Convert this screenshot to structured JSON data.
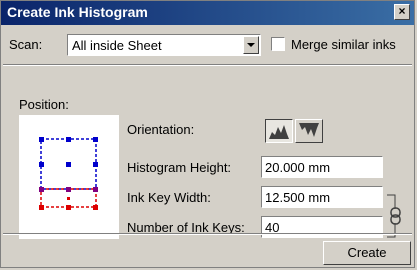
{
  "window": {
    "title": "Create Ink Histogram",
    "close_glyph": "×"
  },
  "scan": {
    "label": "Scan:",
    "selected": "All inside Sheet"
  },
  "merge": {
    "label": "Merge similar inks",
    "checked": false
  },
  "position": {
    "label": "Position:"
  },
  "orientation": {
    "label": "Orientation:",
    "icons": [
      "histogram-up-icon",
      "histogram-down-icon"
    ]
  },
  "fields": {
    "histogram_height": {
      "label": "Histogram Height:",
      "value": "20.000 mm"
    },
    "ink_key_width": {
      "label": "Ink Key Width:",
      "value": "12.500 mm"
    },
    "number_of_ink_keys": {
      "label": "Number of Ink Keys:",
      "value": "40"
    }
  },
  "link_icon": "chain-link-icon",
  "create_button": {
    "label": "Create"
  },
  "colors": {
    "title_bar": "#0a246a",
    "sheet_outline": "#0000cc",
    "histogram_outline": "#dd0000"
  }
}
